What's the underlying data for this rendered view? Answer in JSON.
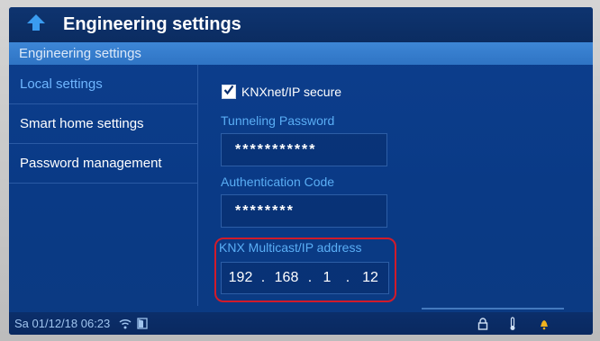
{
  "header": {
    "title": "Engineering settings"
  },
  "subheader": {
    "title": "Engineering settings"
  },
  "sidebar": {
    "items": [
      {
        "label": "Local settings",
        "active": true
      },
      {
        "label": "Smart home settings",
        "active": false
      },
      {
        "label": "Password management",
        "active": false
      }
    ]
  },
  "main": {
    "secure_checkbox": {
      "label": "KNXnet/IP secure",
      "checked": true
    },
    "tunneling_password": {
      "label": "Tunneling Password",
      "value": "***********"
    },
    "authentication_code": {
      "label": "Authentication Code",
      "value": "********"
    },
    "multicast": {
      "label": "KNX Multicast/IP address",
      "octets": [
        "192",
        "168",
        "1",
        "12"
      ],
      "separator": "."
    }
  },
  "statusbar": {
    "datetime": "Sa 01/12/18  06:23",
    "icons": [
      "wifi-icon",
      "door-icon",
      "lock-icon",
      "thermometer-icon",
      "bell-icon"
    ]
  },
  "colors": {
    "accent": "#5aaef5",
    "highlight_box": "#d11b2a",
    "screen_bg": "#0a3a86"
  }
}
